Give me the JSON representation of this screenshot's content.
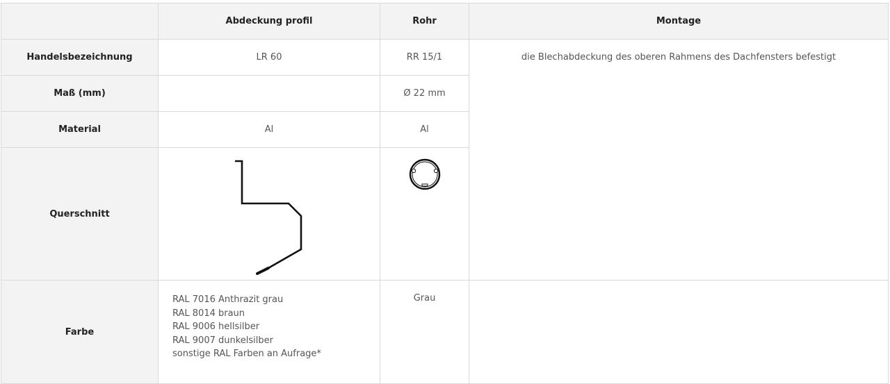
{
  "table": {
    "headers": [
      "",
      "Abdeckung profil",
      "Rohr",
      "Montage"
    ],
    "rows": {
      "handelsbezeichnung": {
        "label": "Handelsbezeichnung",
        "profil": "LR 60",
        "rohr": "RR 15/1",
        "montage": "die Blechabdeckung des oberen Rahmens des Dachfensters befestigt"
      },
      "mass": {
        "label": "Maß (mm)",
        "profil": "",
        "rohr": "Ø 22 mm"
      },
      "material": {
        "label": "Material",
        "profil": "Al",
        "rohr": "Al"
      },
      "querschnitt": {
        "label": "Querschnitt"
      },
      "farbe": {
        "label": "Farbe",
        "profil": [
          "RAL 7016 Anthrazit grau",
          "RAL 8014 braun",
          "RAL 9006 hellsilber",
          "RAL 9007 dunkelsilber",
          "sonstige RAL Farben an Aufrage*"
        ],
        "rohr": "Grau",
        "montage": ""
      }
    }
  },
  "colors": {
    "header_bg": "#f3f3f3",
    "border": "#d9d9d9",
    "drawing": "#111111"
  },
  "icons": {
    "profile": "lr60-profile-drawing",
    "pipe": "rr15-pipe-cross-section"
  }
}
